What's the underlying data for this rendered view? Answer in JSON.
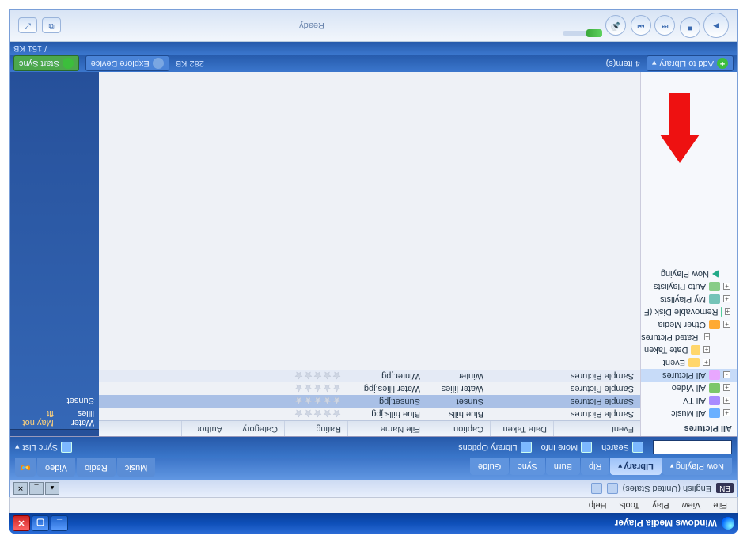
{
  "titlebar": {
    "title": "Windows Media Player"
  },
  "menubar": {
    "items": [
      "File",
      "View",
      "Play",
      "Tools",
      "Help"
    ]
  },
  "langbar": {
    "tag": "EN",
    "name": "English (United States)"
  },
  "tabs": {
    "left": [
      {
        "label": "Now Playing",
        "drop": true
      },
      {
        "label": "Library",
        "active": true,
        "drop": true
      },
      {
        "label": "Rip"
      },
      {
        "label": "Burn"
      },
      {
        "label": "Sync"
      },
      {
        "label": "Guide"
      }
    ],
    "right": [
      {
        "label": "Music"
      },
      {
        "label": "Radio"
      },
      {
        "label": "Video"
      }
    ]
  },
  "subbar": {
    "search": "Search",
    "moreinfo": "More Info",
    "libopts": "Library Options",
    "synclist": "Sync List"
  },
  "sidebar": {
    "header": "All Pictures",
    "items": [
      {
        "label": "All Music",
        "icon": "music",
        "exp": "+"
      },
      {
        "label": "All TV",
        "icon": "tv",
        "exp": "+"
      },
      {
        "label": "All Video",
        "icon": "video",
        "exp": "+"
      },
      {
        "label": "All Pictures",
        "icon": "pic",
        "exp": "-",
        "active": true
      },
      {
        "label": "Event",
        "icon": "pic2",
        "indent": true,
        "exp": "+"
      },
      {
        "label": "Date Taken",
        "icon": "pic2",
        "indent": true,
        "exp": "+"
      },
      {
        "label": "Rated Pictures",
        "icon": "rp",
        "indent": true,
        "exp": "+"
      },
      {
        "label": "Other Media",
        "icon": "om",
        "exp": "+"
      },
      {
        "label": "Removable Disk (F",
        "icon": "rd",
        "exp": "+"
      },
      {
        "label": "My Playlists",
        "icon": "mp",
        "exp": "+"
      },
      {
        "label": "Auto Playlists",
        "icon": "ap",
        "exp": "+"
      },
      {
        "label": "Now Playing",
        "icon": "np",
        "np": true
      }
    ]
  },
  "columns": [
    "Event",
    "Date Taken",
    "Caption",
    "File Name",
    "Rating",
    "Category",
    "Author"
  ],
  "rows": [
    {
      "event": "Sample Pictures",
      "caption": "Blue hills",
      "file": "Blue hills.jpg",
      "sel": false
    },
    {
      "event": "Sample Pictures",
      "caption": "Sunset",
      "file": "Sunset.jpg",
      "sel": true
    },
    {
      "event": "Sample Pictures",
      "caption": "Water lilies",
      "file": "Water lilies.jpg",
      "sel": false
    },
    {
      "event": "Sample Pictures",
      "caption": "Winter",
      "file": "Winter.jpg",
      "sel": false
    }
  ],
  "syncpane": {
    "warn": "May not fit",
    "items": [
      {
        "name": "Water lilies"
      },
      {
        "name": "Sunset"
      }
    ]
  },
  "bluebar": {
    "add": "Add to Library",
    "count": "4 Item(s)",
    "size": "282 KB",
    "explore": "Explore Device",
    "start": "Start Sync",
    "devsize": "/ 151 KB"
  },
  "player": {
    "status": "Ready"
  }
}
